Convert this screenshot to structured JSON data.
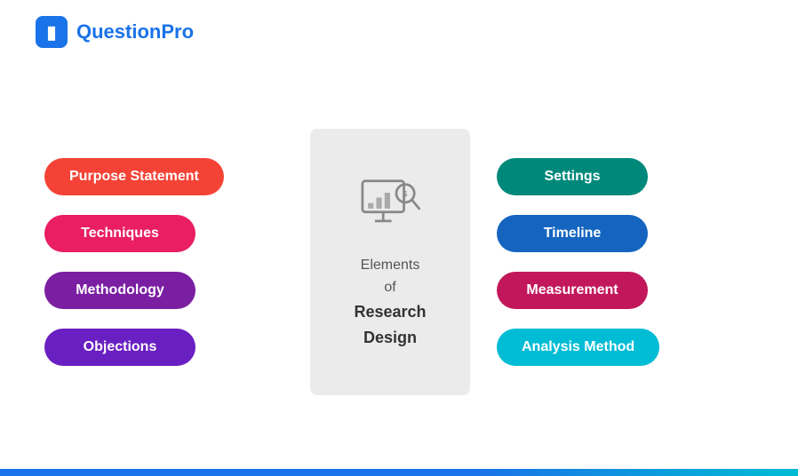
{
  "logo": {
    "icon_label": "p",
    "text_part1": "Question",
    "text_part2": "Pro"
  },
  "center": {
    "line1": "Elements",
    "line2": "of",
    "line3": "Research",
    "line4": "Design"
  },
  "left_pills": [
    {
      "label": "Purpose Statement",
      "color_class": "pill-red"
    },
    {
      "label": "Techniques",
      "color_class": "pill-pink"
    },
    {
      "label": "Methodology",
      "color_class": "pill-purple-dark"
    },
    {
      "label": "Objections",
      "color_class": "pill-purple"
    }
  ],
  "right_pills": [
    {
      "label": "Settings",
      "color_class": "pill-teal"
    },
    {
      "label": "Timeline",
      "color_class": "pill-blue"
    },
    {
      "label": "Measurement",
      "color_class": "pill-magenta"
    },
    {
      "label": "Analysis Method",
      "color_class": "pill-cyan"
    }
  ]
}
